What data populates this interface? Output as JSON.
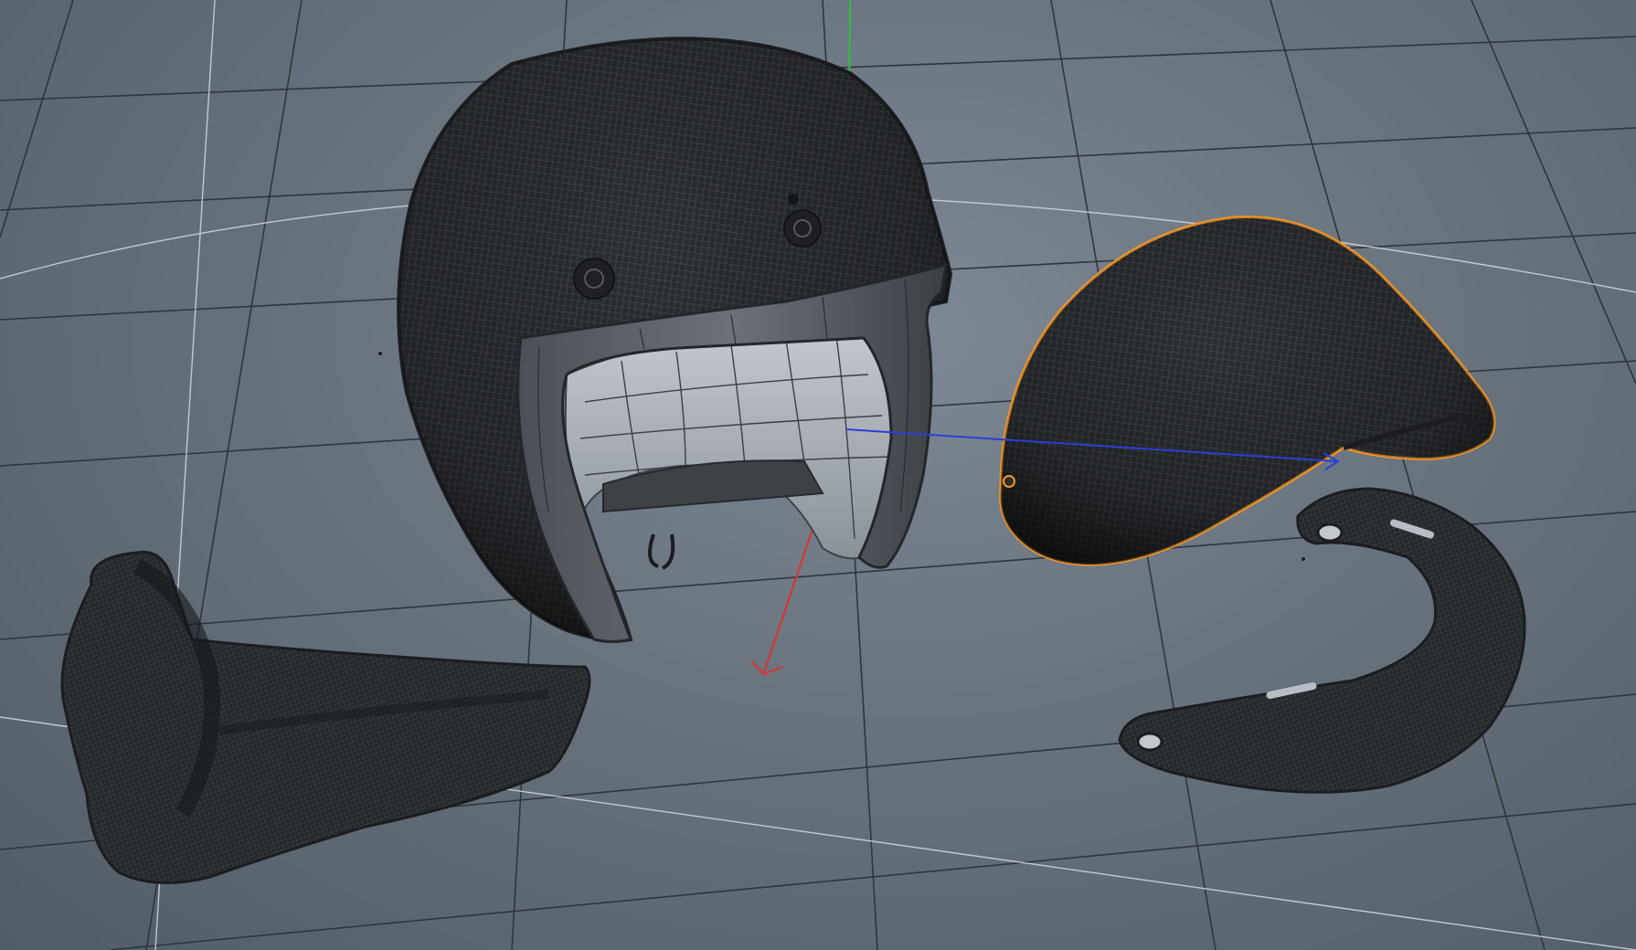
{
  "viewport": {
    "colors": {
      "background": "#6b7580",
      "grid_line": "#2f353c",
      "grid_highlight": "#c9cfd6",
      "mesh_fill": "#2b2e32",
      "wire": "#7a7f86",
      "selection_outline": "#f0962b",
      "axis_x": "#e0302a",
      "axis_y": "#30c23a",
      "axis_z": "#2a3fd8"
    }
  },
  "objects": [
    {
      "name": "helmet-shell",
      "selected": false
    },
    {
      "name": "visor-peak",
      "selected": true
    },
    {
      "name": "chin-guard",
      "selected": false
    },
    {
      "name": "visor-strap",
      "selected": false
    }
  ],
  "gizmo": {
    "axes": [
      "x",
      "y",
      "z"
    ]
  }
}
